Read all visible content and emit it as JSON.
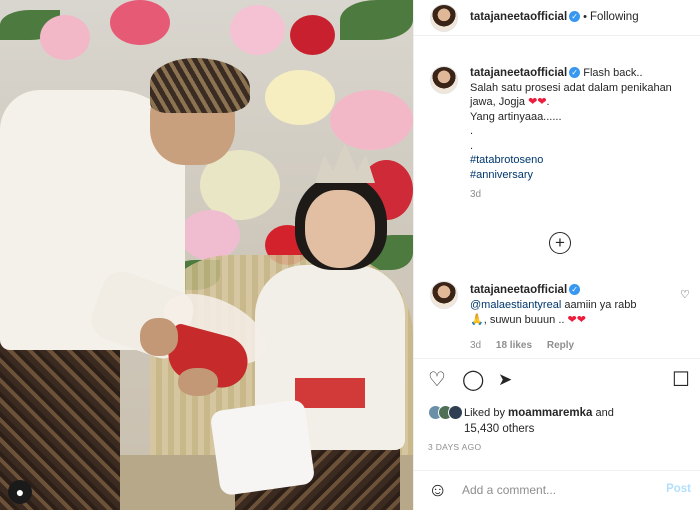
{
  "post": {
    "username": "tatajaneetaofficial",
    "following_label": "Following",
    "caption_lines": [
      "Flash back..",
      "Salah satu prosesi adat dalam penikahan",
      "jawa, Jogja",
      "Yang artinyaaa......",
      ".",
      "."
    ],
    "hashtags": [
      "#tatabrotoseno",
      "#anniversary"
    ],
    "caption_age": "3d"
  },
  "comment": {
    "username": "tatajaneetaofficial",
    "mention": "@malaestiantyreal",
    "text_1": " aamiin ya rabb",
    "text_2": ", suwun buuun ..",
    "age": "3d",
    "likes": "18 likes",
    "reply_label": "Reply"
  },
  "likes": {
    "liked_by_prefix": "Liked by",
    "liked_by_user": "moammaremka",
    "and": "and",
    "count": "15,430 others"
  },
  "timestamp": "3 DAYS AGO",
  "composer": {
    "placeholder": "Add a comment...",
    "post_label": "Post"
  },
  "icons": {
    "heart": "heart-icon",
    "comment": "comment-icon",
    "share": "share-icon",
    "save": "bookmark-icon",
    "more": "plus-circle-icon",
    "emoji": "emoji-icon"
  },
  "colors": {
    "verified": "#3897f0",
    "link": "#00376b",
    "heart": "#ed1c3c",
    "post_disabled": "#b2dffc"
  }
}
